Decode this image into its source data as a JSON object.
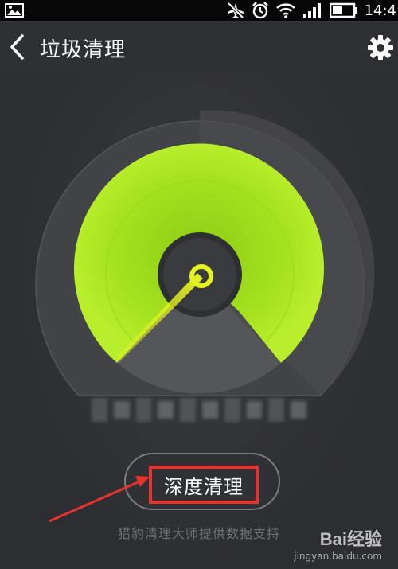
{
  "status_bar": {
    "time": "14:4",
    "icons": [
      "picture-icon",
      "airplane-mode-icon",
      "alarm-icon",
      "wifi-icon",
      "signal-icon",
      "battery-icon"
    ]
  },
  "nav": {
    "title": "垃圾清理",
    "back_icon": "chevron-left-icon",
    "settings_icon": "gear-icon"
  },
  "gauge": {
    "accent_color": "#a6e21f",
    "needle_color": "#e6f41e"
  },
  "deep_clean_button": {
    "label": "深度清理"
  },
  "footer": {
    "credit": "猎豹清理大师提供数据支持"
  },
  "watermark": {
    "logo": "Bai经验",
    "url": "jingyan.baidu.com"
  }
}
